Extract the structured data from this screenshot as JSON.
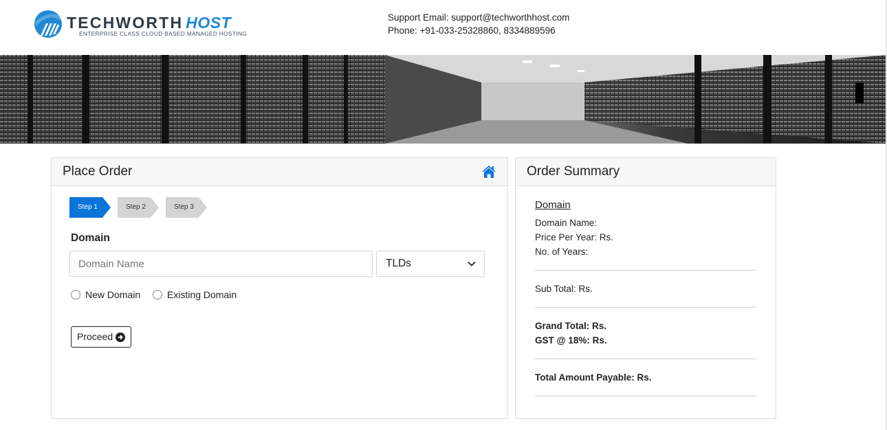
{
  "brand": {
    "name": "TECHWORTH",
    "name_suffix": "HOST",
    "tagline": "ENTERPRISE CLASS CLOUD BASED MANAGED HOSTING"
  },
  "contact": {
    "email_line": "Support Email: support@techworthhost.com",
    "phone_line": "Phone: +91-033-25328860, 8334889596"
  },
  "place_order": {
    "title": "Place Order",
    "steps": [
      "Step 1",
      "Step 2",
      "Step 3"
    ],
    "active_step": 1,
    "section_label": "Domain",
    "domain_input": {
      "placeholder": "Domain Name",
      "value": ""
    },
    "tld_select": {
      "selected": "TLDs"
    },
    "radio_options": [
      {
        "label": "New Domain",
        "checked": false
      },
      {
        "label": "Existing Domain",
        "checked": false
      }
    ],
    "proceed_label": "Proceed"
  },
  "order_summary": {
    "title": "Order Summary",
    "domain_link": "Domain",
    "domain_name": "Domain Name:",
    "price_per_year": "Price Per Year: Rs.",
    "years": "No. of Years:",
    "sub_total": "Sub Total: Rs.",
    "grand_total": "Grand Total: Rs.",
    "gst": "GST @ 18%: Rs.",
    "total_payable": "Total Amount Payable: Rs."
  },
  "colors": {
    "accent": "#0a74da",
    "step_inactive": "#d4d4d4",
    "brand_blue": "#1e88d4"
  },
  "icons": [
    "home-icon",
    "chevron-down-icon",
    "arrow-circle-right-icon",
    "logo-mark-icon"
  ]
}
